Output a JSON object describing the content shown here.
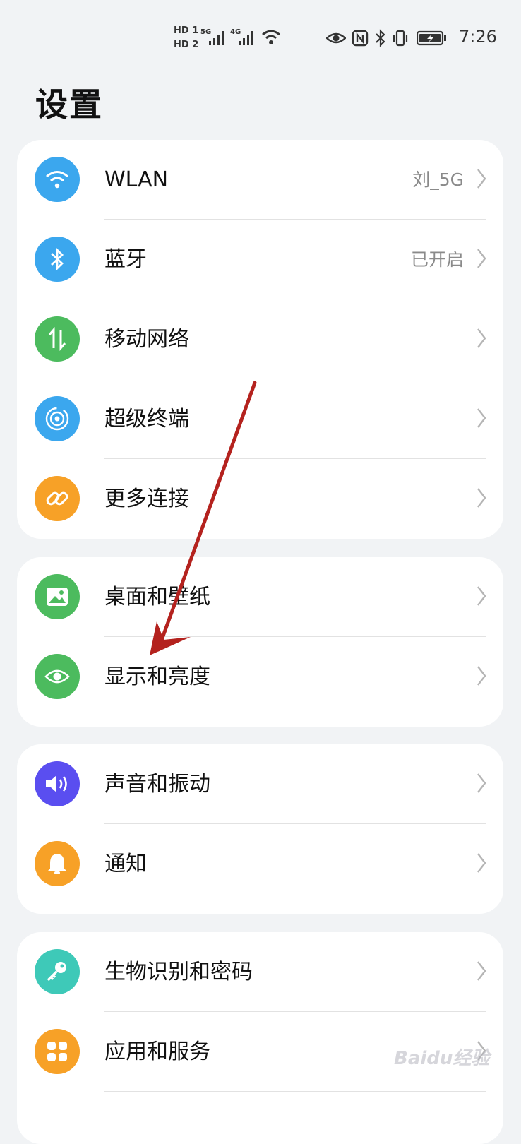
{
  "status_bar": {
    "hd1": "HD 1",
    "hd2": "HD 2",
    "sig1_label": "5G",
    "sig2_label": "4G",
    "time": "7:26"
  },
  "page": {
    "title": "设置"
  },
  "groups": [
    {
      "items": [
        {
          "label": "WLAN",
          "value": "刘_5G",
          "icon": "wifi-icon",
          "color": "#3ba7ee"
        },
        {
          "label": "蓝牙",
          "value": "已开启",
          "icon": "bluetooth-icon",
          "color": "#3ba7ee"
        },
        {
          "label": "移动网络",
          "value": "",
          "icon": "mobile-data-icon",
          "color": "#4cbb5e"
        },
        {
          "label": "超级终端",
          "value": "",
          "icon": "super-device-icon",
          "color": "#3ba7ee"
        },
        {
          "label": "更多连接",
          "value": "",
          "icon": "link-icon",
          "color": "#f7a127"
        }
      ]
    },
    {
      "items": [
        {
          "label": "桌面和壁纸",
          "value": "",
          "icon": "wallpaper-icon",
          "color": "#4cbb5e"
        },
        {
          "label": "显示和亮度",
          "value": "",
          "icon": "eye-icon",
          "color": "#4cbb5e"
        }
      ]
    },
    {
      "items": [
        {
          "label": "声音和振动",
          "value": "",
          "icon": "speaker-icon",
          "color": "#5a4ef0"
        },
        {
          "label": "通知",
          "value": "",
          "icon": "bell-icon",
          "color": "#f7a127"
        }
      ]
    },
    {
      "items": [
        {
          "label": "生物识别和密码",
          "value": "",
          "icon": "key-icon",
          "color": "#3ec9b8"
        },
        {
          "label": "应用和服务",
          "value": "",
          "icon": "apps-icon",
          "color": "#f7a127"
        }
      ]
    }
  ],
  "annotation": {
    "arrow_color": "#b4221e"
  },
  "watermark": "Baidu经验"
}
